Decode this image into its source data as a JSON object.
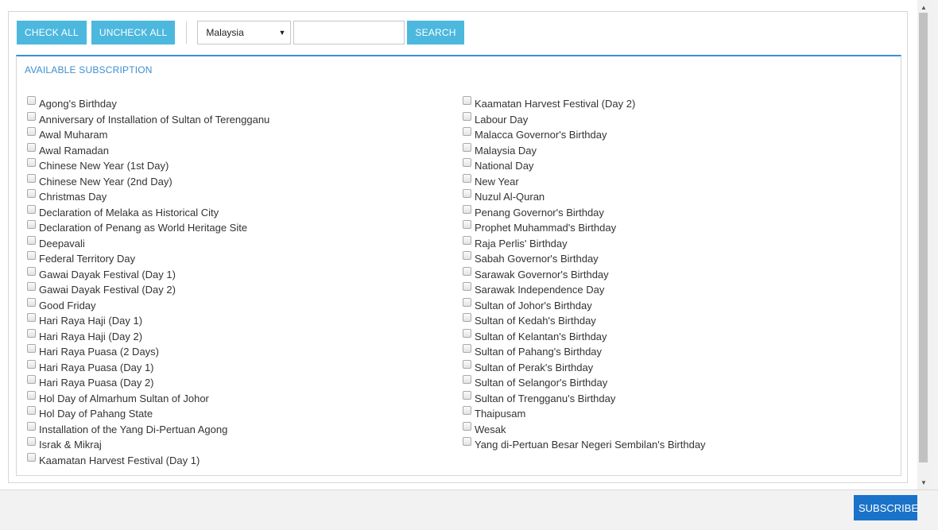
{
  "toolbar": {
    "check_all_label": "CHECK ALL",
    "uncheck_all_label": "UNCHECK ALL",
    "country_selected": "Malaysia",
    "search_value": "",
    "search_label": "SEARCH"
  },
  "section": {
    "title": "AVAILABLE SUBSCRIPTION"
  },
  "left_items": [
    "Agong's Birthday",
    "Anniversary of Installation of Sultan of Terengganu",
    "Awal Muharam",
    "Awal Ramadan",
    "Chinese New Year (1st Day)",
    "Chinese New Year (2nd Day)",
    "Christmas Day",
    "Declaration of Melaka as Historical City",
    "Declaration of Penang as World Heritage Site",
    "Deepavali",
    "Federal Territory Day",
    "Gawai Dayak Festival (Day 1)",
    "Gawai Dayak Festival (Day 2)",
    "Good Friday",
    "Hari Raya Haji (Day 1)",
    "Hari Raya Haji (Day 2)",
    "Hari Raya Puasa (2 Days)",
    "Hari Raya Puasa (Day 1)",
    "Hari Raya Puasa (Day 2)",
    "Hol Day of Almarhum Sultan of Johor",
    "Hol Day of Pahang State",
    "Installation of the Yang Di-Pertuan Agong",
    "Israk & Mikraj",
    "Kaamatan Harvest Festival (Day 1)"
  ],
  "right_items": [
    "Kaamatan Harvest Festival (Day 2)",
    "Labour Day",
    "Malacca Governor's Birthday",
    "Malaysia Day",
    "National Day",
    "New Year",
    "Nuzul Al-Quran",
    "Penang Governor's Birthday",
    "Prophet Muhammad's Birthday",
    "Raja Perlis' Birthday",
    "Sabah Governor's Birthday",
    "Sarawak Governor's Birthday",
    "Sarawak Independence Day",
    "Sultan of Johor's Birthday",
    "Sultan of Kedah's Birthday",
    "Sultan of Kelantan's Birthday",
    "Sultan of Pahang's Birthday",
    "Sultan of Perak's Birthday",
    "Sultan of Selangor's Birthday",
    "Sultan of Trengganu's Birthday",
    "Thaipusam",
    "Wesak",
    "Yang di-Pertuan Besar Negeri Sembilan's Birthday"
  ],
  "footer": {
    "subscribe_label": "SUBSCRIBE"
  },
  "colors": {
    "accent": "#4cb8de",
    "title": "#3d8fd1",
    "primary": "#1a73c9"
  },
  "icons": {
    "select_caret": "caret-down-icon",
    "scroll_up": "scroll-up-arrow-icon",
    "scroll_down": "scroll-down-arrow-icon"
  }
}
